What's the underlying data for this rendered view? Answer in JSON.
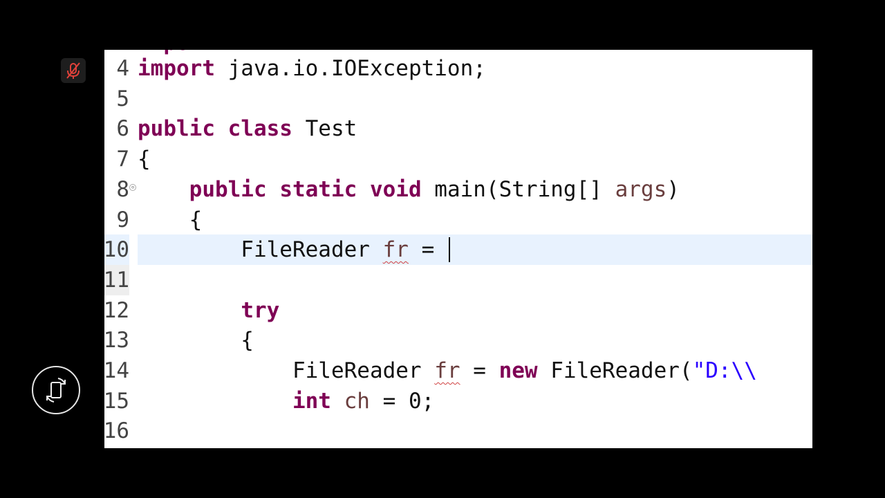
{
  "editor": {
    "cutoff_fragment": "import",
    "lines": [
      {
        "num": "4",
        "tokens": [
          {
            "t": "import",
            "c": "kw"
          },
          {
            "t": " java.io.IOException;",
            "c": "plain"
          }
        ]
      },
      {
        "num": "5",
        "tokens": []
      },
      {
        "num": "6",
        "tokens": [
          {
            "t": "public",
            "c": "kw"
          },
          {
            "t": " ",
            "c": "plain"
          },
          {
            "t": "class",
            "c": "kw"
          },
          {
            "t": " Test",
            "c": "plain"
          }
        ]
      },
      {
        "num": "7",
        "tokens": [
          {
            "t": "{",
            "c": "plain"
          }
        ]
      },
      {
        "num": "8",
        "tokens": [
          {
            "t": "    ",
            "c": "plain"
          },
          {
            "t": "public",
            "c": "kw"
          },
          {
            "t": " ",
            "c": "plain"
          },
          {
            "t": "static",
            "c": "kw"
          },
          {
            "t": " ",
            "c": "plain"
          },
          {
            "t": "void",
            "c": "kw"
          },
          {
            "t": " main(String[] ",
            "c": "plain"
          },
          {
            "t": "args",
            "c": "var"
          },
          {
            "t": ")",
            "c": "plain"
          }
        ]
      },
      {
        "num": "9",
        "tokens": [
          {
            "t": "    {",
            "c": "plain"
          }
        ]
      },
      {
        "num": "10",
        "tokens": [
          {
            "t": "        FileReader ",
            "c": "plain"
          },
          {
            "t": "fr",
            "c": "var squig"
          },
          {
            "t": " = ",
            "c": "plain"
          }
        ]
      },
      {
        "num": "11",
        "tokens": []
      },
      {
        "num": "12",
        "tokens": [
          {
            "t": "        ",
            "c": "plain"
          },
          {
            "t": "try",
            "c": "kw"
          }
        ]
      },
      {
        "num": "13",
        "tokens": [
          {
            "t": "        {",
            "c": "plain"
          }
        ]
      },
      {
        "num": "14",
        "tokens": [
          {
            "t": "            FileReader ",
            "c": "plain"
          },
          {
            "t": "fr",
            "c": "var squig"
          },
          {
            "t": " = ",
            "c": "plain"
          },
          {
            "t": "new",
            "c": "kw"
          },
          {
            "t": " FileReader(",
            "c": "plain"
          },
          {
            "t": "\"D:\\\\",
            "c": "str"
          }
        ]
      },
      {
        "num": "15",
        "tokens": [
          {
            "t": "            ",
            "c": "plain"
          },
          {
            "t": "int",
            "c": "kw"
          },
          {
            "t": " ",
            "c": "plain"
          },
          {
            "t": "ch",
            "c": "var"
          },
          {
            "t": " = 0;",
            "c": "plain"
          }
        ]
      },
      {
        "num": "16",
        "tokens": []
      }
    ],
    "current_line": "10",
    "fold_line": "8",
    "fold_glyph": "⊖"
  },
  "overlay": {
    "mic_icon": "mic-muted-icon",
    "rotate_icon": "rotate-screen-icon",
    "accent_red": "#e0413a"
  }
}
